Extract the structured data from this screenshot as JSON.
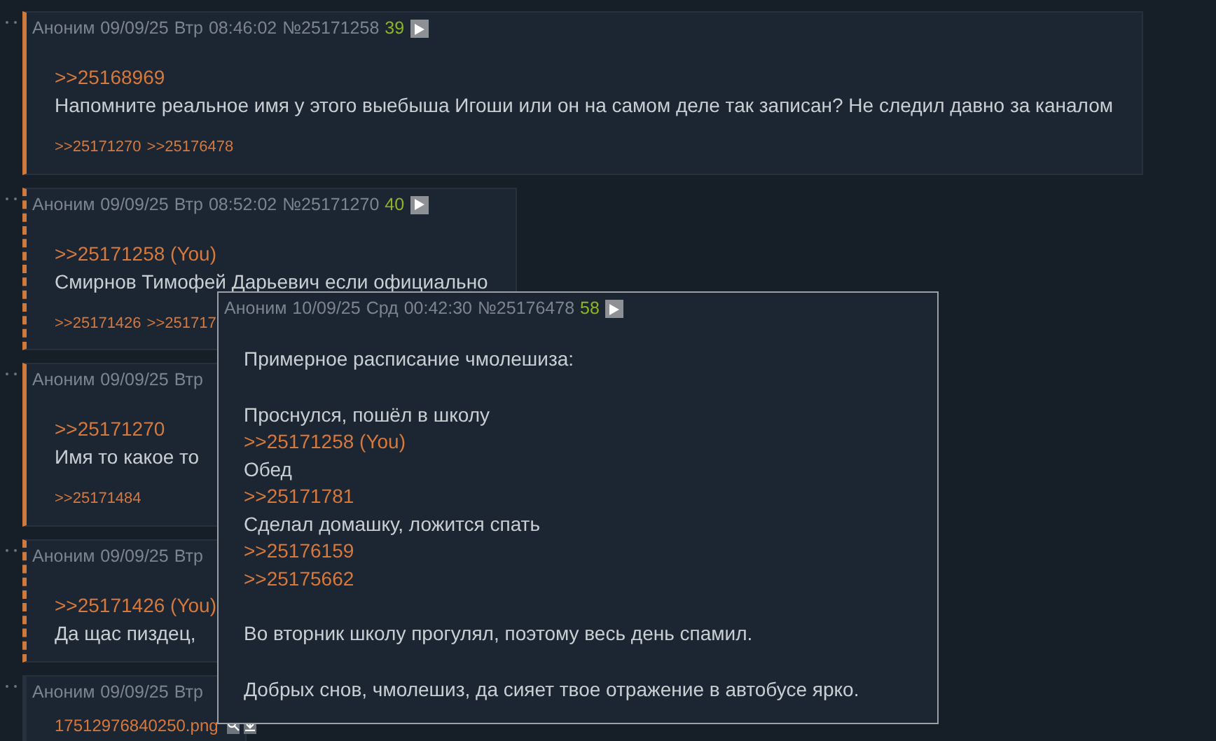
{
  "posts": [
    {
      "author": "Аноним",
      "date": "09/09/25",
      "weekday": "Втр",
      "time": "08:46:02",
      "number": "№25171258",
      "score": "39",
      "own": true,
      "replies_to_you": false,
      "body": [
        {
          "kind": "quote",
          "text": ">>25168969"
        },
        {
          "kind": "text",
          "text": "Напомните реальное имя у этого выебыша Игоши или он на самом деле так записан? Не следил давно за каналом"
        }
      ],
      "backlinks": [
        ">>25171270",
        ">>25176478"
      ]
    },
    {
      "author": "Аноним",
      "date": "09/09/25",
      "weekday": "Втр",
      "time": "08:52:02",
      "number": "№25171270",
      "score": "40",
      "own": false,
      "replies_to_you": true,
      "body": [
        {
          "kind": "quote",
          "text": ">>25171258 (You)"
        },
        {
          "kind": "text",
          "text": "Смирнов Тимофей Дарьевич если официально"
        }
      ],
      "backlinks": [
        ">>25171426",
        ">>251717"
      ]
    },
    {
      "author": "Аноним",
      "date": "09/09/25",
      "weekday": "Втр",
      "own": true,
      "replies_to_you": false,
      "body": [
        {
          "kind": "quote",
          "text": ">>25171270"
        },
        {
          "kind": "text",
          "text": "Имя то какое то"
        }
      ],
      "backlinks": [
        ">>25171484"
      ]
    },
    {
      "author": "Аноним",
      "date": "09/09/25",
      "weekday": "Втр",
      "own": false,
      "replies_to_you": true,
      "body": [
        {
          "kind": "quote",
          "text": ">>25171426 (You)"
        },
        {
          "kind": "text",
          "text": "Да щас пиздец,"
        }
      ]
    },
    {
      "author": "Аноним",
      "date": "09/09/25",
      "weekday": "Втр",
      "own": false,
      "replies_to_you": false,
      "file": {
        "name": "17512976840250.png"
      }
    }
  ],
  "popup": {
    "author": "Аноним",
    "date": "10/09/25",
    "weekday": "Срд",
    "time": "00:42:30",
    "number": "№25176478",
    "score": "58",
    "body": [
      {
        "kind": "text",
        "text": "Примерное расписание чмолешиза:"
      },
      {
        "kind": "blank"
      },
      {
        "kind": "text",
        "text": "Проснулся, пошёл в школу"
      },
      {
        "kind": "quote",
        "text": ">>25171258 (You)"
      },
      {
        "kind": "text",
        "text": "Обед"
      },
      {
        "kind": "quote",
        "text": ">>25171781"
      },
      {
        "kind": "text",
        "text": "Сделал домашку, ложится спать"
      },
      {
        "kind": "quote",
        "text": ">>25176159"
      },
      {
        "kind": "quote",
        "text": ">>25175662"
      },
      {
        "kind": "blank"
      },
      {
        "kind": "text",
        "text": "Во вторник школу прогулял, поэтому весь день спамил."
      },
      {
        "kind": "blank"
      },
      {
        "kind": "text",
        "text": "Добрых снов, чмолешиз, да сияет твое отражение в автобусе ярко."
      }
    ]
  }
}
